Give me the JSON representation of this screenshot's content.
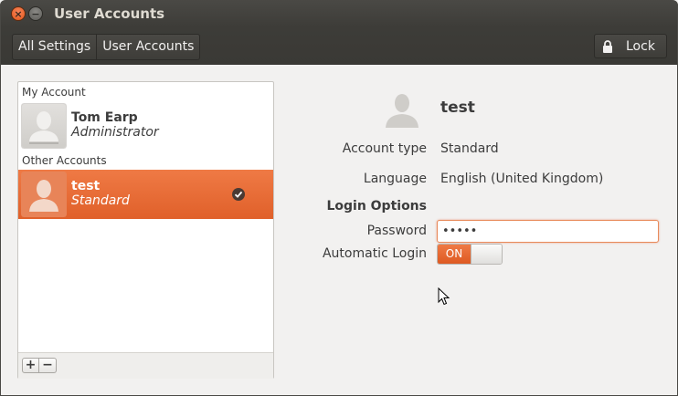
{
  "window": {
    "title": "User Accounts",
    "close_glyph": "×",
    "minimize_glyph": "−"
  },
  "toolbar": {
    "breadcrumbs": [
      "All Settings",
      "User Accounts"
    ],
    "lock_label": "Lock",
    "lock_icon": "lock-icon"
  },
  "accounts": {
    "my_account_label": "My Account",
    "other_accounts_label": "Other Accounts",
    "users": [
      {
        "name": "Tom Earp",
        "role": "Administrator",
        "selected": false
      },
      {
        "name": "test",
        "role": "Standard",
        "selected": true
      }
    ],
    "add_label": "+",
    "remove_label": "−"
  },
  "details": {
    "name": "test",
    "account_type_label": "Account type",
    "account_type_value": "Standard",
    "language_label": "Language",
    "language_value": "English (United Kingdom)",
    "login_options_heading": "Login Options",
    "password_label": "Password",
    "password_value": "•••••",
    "automatic_login_label": "Automatic Login",
    "automatic_login_state": "ON"
  },
  "colors": {
    "accent": "#e9602a",
    "titlebar": "#3d3c38",
    "background": "#f2f1f0"
  }
}
